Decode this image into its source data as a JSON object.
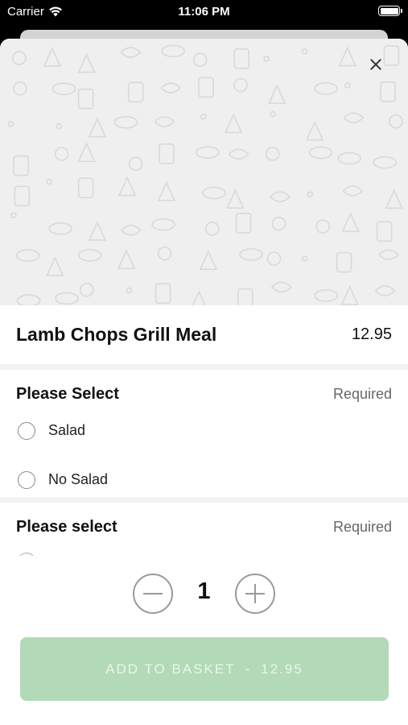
{
  "status_bar": {
    "carrier": "Carrier",
    "time": "11:06 PM"
  },
  "item": {
    "name": "Lamb Chops Grill Meal",
    "price": "12.95"
  },
  "sections": [
    {
      "title": "Please Select",
      "requirement": "Required",
      "options": [
        {
          "label": "Salad"
        },
        {
          "label": "No Salad"
        }
      ]
    },
    {
      "title": "Please select",
      "requirement": "Required"
    }
  ],
  "quantity": {
    "value": "1"
  },
  "add_button": {
    "label": "ADD TO BASKET",
    "separator": "-",
    "price": "12.95"
  },
  "colors": {
    "add_button_bg": "#b2dab6",
    "pattern_stroke": "#d9d9d9"
  },
  "icons": {
    "close": "close-icon",
    "minus": "minus-icon",
    "plus": "plus-icon",
    "wifi": "wifi-icon"
  }
}
